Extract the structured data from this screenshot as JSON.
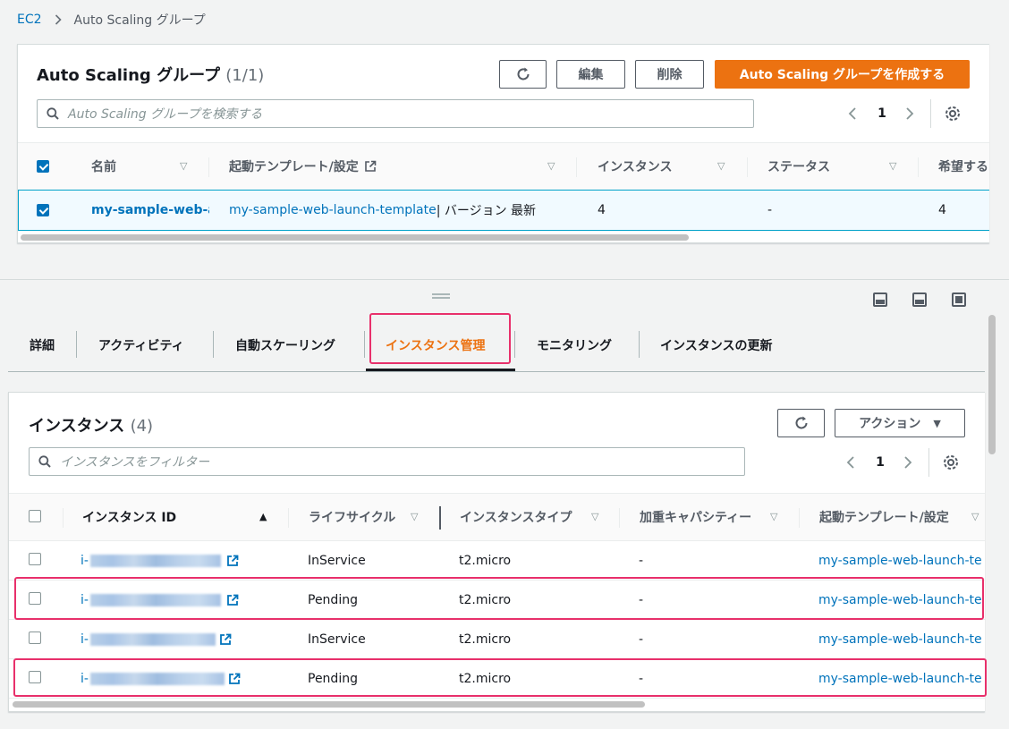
{
  "breadcrumb": {
    "root": "EC2",
    "current": "Auto Scaling グループ"
  },
  "asg_panel": {
    "title": "Auto Scaling グループ",
    "count": "(1/1)",
    "edit_label": "編集",
    "delete_label": "削除",
    "create_label": "Auto Scaling グループを作成する",
    "search_placeholder": "Auto Scaling グループを検索する",
    "page": "1",
    "columns": [
      "名前",
      "起動テンプレート/設定",
      "インスタンス",
      "ステータス",
      "希望する"
    ],
    "row": {
      "name": "my-sample-web-a",
      "template": "my-sample-web-launch-template",
      "version": " | バージョン 最新",
      "instances": "4",
      "status": "-",
      "desired": "4"
    }
  },
  "tabs": [
    "詳細",
    "アクティビティ",
    "自動スケーリング",
    "インスタンス管理",
    "モニタリング",
    "インスタンスの更新"
  ],
  "active_tab": "インスタンス管理",
  "instances_panel": {
    "title": "インスタンス",
    "count": "(4)",
    "actions_label": "アクション",
    "search_placeholder": "インスタンスをフィルター",
    "page": "1",
    "columns": [
      "インスタンス ID",
      "ライフサイクル",
      "インスタンスタイプ",
      "加重キャパシティー",
      "起動テンプレート/設定"
    ],
    "rows": [
      {
        "id_prefix": "i-",
        "lifecycle": "InService",
        "type": "t2.micro",
        "weight": "-",
        "template": "my-sample-web-launch-te"
      },
      {
        "id_prefix": "i-",
        "lifecycle": "Pending",
        "type": "t2.micro",
        "weight": "-",
        "template": "my-sample-web-launch-te"
      },
      {
        "id_prefix": "i-",
        "lifecycle": "InService",
        "type": "t2.micro",
        "weight": "-",
        "template": "my-sample-web-launch-te"
      },
      {
        "id_prefix": "i-",
        "lifecycle": "Pending",
        "type": "t2.micro",
        "weight": "-",
        "template": "my-sample-web-launch-te"
      }
    ]
  },
  "colors": {
    "accent": "#ec7211",
    "link": "#0073bb",
    "highlight": "#e8306b"
  }
}
